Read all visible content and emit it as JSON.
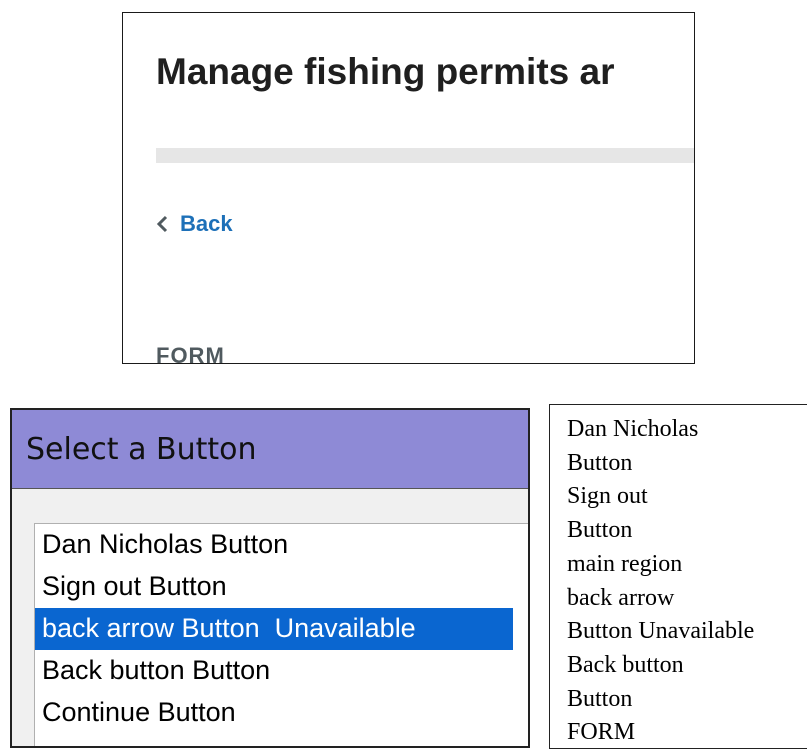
{
  "web_page": {
    "title": "Manage fishing permits ar",
    "back_label": "Back",
    "form_heading": "FORM"
  },
  "screen_reader_dialog": {
    "title": "Select a Button",
    "items": [
      "Dan Nicholas Button",
      "Sign out Button",
      "back arrow Button  Unavailable",
      "Back button Button",
      "Continue Button"
    ],
    "selected_index": 2
  },
  "text_panel": {
    "lines": [
      "Dan Nicholas",
      "Button",
      "Sign out",
      "Button",
      "main region",
      "back arrow",
      "Button Unavailable",
      "Back button",
      "Button",
      "FORM"
    ]
  },
  "colors": {
    "link": "#1d70b8",
    "dialog_title_bar": "#8e8ad6",
    "selection": "#0a66d0"
  },
  "icons": {
    "back": "chevron-left-icon"
  }
}
